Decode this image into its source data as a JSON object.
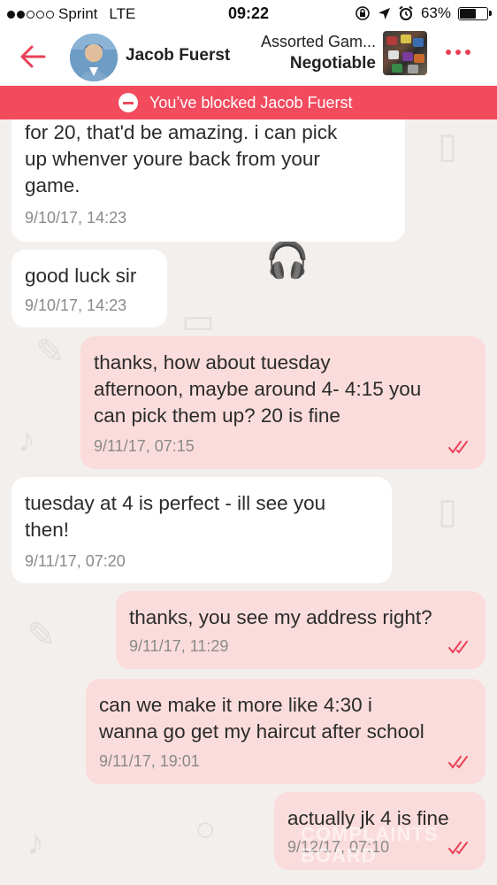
{
  "status_bar": {
    "carrier": "Sprint",
    "network": "LTE",
    "time": "09:22",
    "battery": "63%",
    "battery_level": 0.63
  },
  "header": {
    "contact_name": "Jacob Fuerst",
    "item_title": "Assorted Gam...",
    "item_price": "Negotiable",
    "back_icon": "arrow-left-icon",
    "more_icon": "more-dots-icon",
    "accent_color": "#e94055"
  },
  "blocked_banner": {
    "text": "You’ve blocked Jacob Fuerst",
    "color": "#f24b5e"
  },
  "messages": [
    {
      "dir": "in",
      "lines": [
        "for 20, that'd be amazing. i can pick",
        "up whenver youre back from your",
        "game."
      ],
      "time": "9/10/17, 14:23"
    },
    {
      "dir": "in",
      "lines": [
        "good luck sir"
      ],
      "time": "9/10/17, 14:23"
    },
    {
      "dir": "out",
      "lines": [
        "thanks, how about tuesday",
        "afternoon, maybe around 4- 4:15 you",
        "can pick them up? 20 is fine"
      ],
      "time": "9/11/17, 07:15"
    },
    {
      "dir": "in",
      "lines": [
        "tuesday at 4 is perfect - ill see you",
        "then!"
      ],
      "time": "9/11/17, 07:20"
    },
    {
      "dir": "out",
      "lines": [
        "thanks, you see my address right?"
      ],
      "time": "9/11/17, 11:29"
    },
    {
      "dir": "out",
      "lines": [
        "can we make it more like 4:30 i",
        "wanna go get my haircut after school"
      ],
      "time": "9/11/17, 19:01"
    },
    {
      "dir": "out",
      "lines": [
        "actually jk 4 is fine"
      ],
      "time": "9/12/17, 07:10"
    }
  ],
  "watermark": {
    "line1": "COMPLAINTS",
    "line2": "BOARD"
  }
}
